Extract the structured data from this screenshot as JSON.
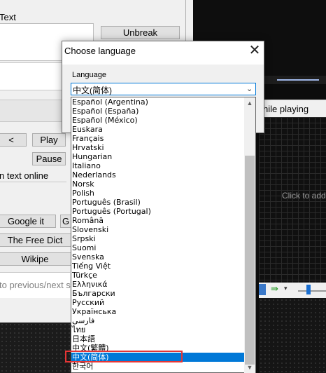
{
  "background": {
    "text_label": "Text",
    "unbreak_button": "Unbreak",
    "play_button": "Play",
    "prev_button": "<",
    "pause_button": "Pause",
    "text_online_label": "n text online",
    "google_button": "Google it",
    "g_button": "G",
    "free_dict_button": "The Free Dict",
    "wikipedia_button": "Wikipe",
    "prev_next_label": "to previous/next s",
    "while_playing_label": "hile playing",
    "click_to_add": "Click to add"
  },
  "dialog": {
    "title": "Choose language",
    "close_glyph": "✕",
    "language_label": "Language",
    "selected_value": "中文(简体)",
    "chevron_glyph": "⌄"
  },
  "dropdown": {
    "items": [
      "Español (Argentina)",
      "Español (España)",
      "Español (México)",
      "Euskara",
      "Français",
      "Hrvatski",
      "Hungarian",
      "Italiano",
      "Nederlands",
      "Norsk",
      "Polish",
      "Português (Brasil)",
      "Português (Portugal)",
      "Română",
      "Slovenski",
      "Srpski",
      "Suomi",
      "Svenska",
      "Tiếng Việt",
      "Türkçe",
      "Ελληνικά",
      "Български",
      "Русский",
      "Українська",
      "فارسی",
      "ไทย",
      "日本語",
      "中文(繁體)",
      "中文(简体)",
      "한국어"
    ],
    "selected_index": 28
  },
  "colors": {
    "selection": "#0078d7",
    "highlight_box": "#e53535"
  }
}
